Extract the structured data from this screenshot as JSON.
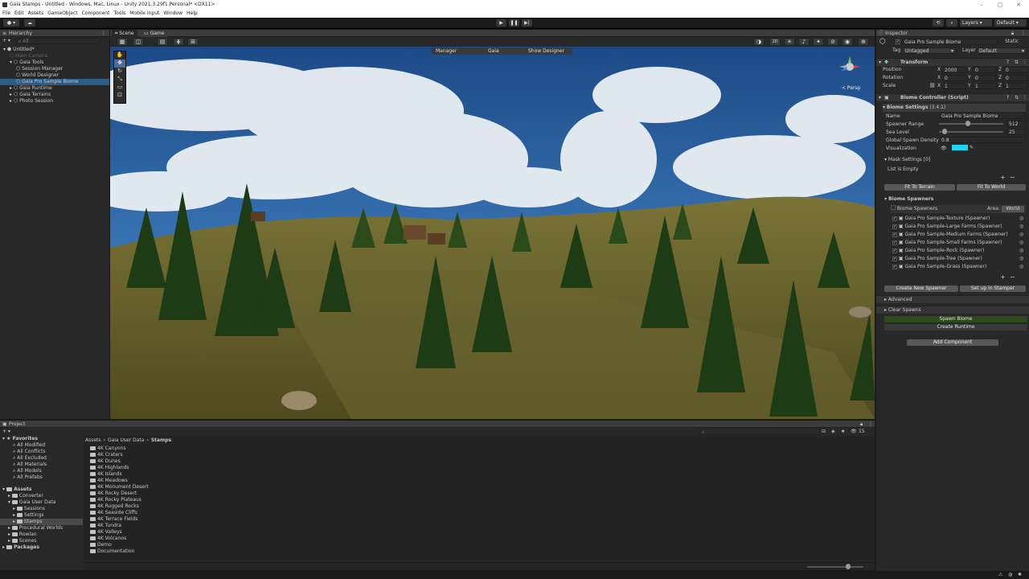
{
  "window": {
    "title": "Gaia Stamps - Untitled - Windows, Mac, Linux - Unity 2021.3.29f1 Personal* <DX11>"
  },
  "menu": [
    "File",
    "Edit",
    "Assets",
    "GameObject",
    "Component",
    "Tools",
    "Mobile Input",
    "Window",
    "Help"
  ],
  "toolbar": {
    "layers": "Layers",
    "layout": "Default"
  },
  "hierarchy": {
    "tab": "Hierarchy",
    "search_placeholder": "All",
    "items": [
      {
        "label": "Untitled*",
        "depth": 0
      },
      {
        "label": "Main Camera",
        "depth": 1
      },
      {
        "label": "Gaia Tools",
        "depth": 1
      },
      {
        "label": "Session Manager",
        "depth": 2
      },
      {
        "label": "World Designer",
        "depth": 2
      },
      {
        "label": "Gaia Pro Sample Biome",
        "depth": 2
      },
      {
        "label": "Gaia Runtime",
        "depth": 1
      },
      {
        "label": "Gaia Terrains",
        "depth": 1
      },
      {
        "label": "Photo Session",
        "depth": 1
      }
    ]
  },
  "scene": {
    "tabs": [
      "Scene",
      "Game"
    ],
    "overlay": {
      "manager": "Manager",
      "gaia": "Gaia",
      "show_designer": "Show Designer"
    },
    "mode_2d": "2D",
    "persp": "< Persp"
  },
  "inspector": {
    "tab": "Inspector",
    "object_name": "Gaia Pro Sample Biome",
    "static": "Static",
    "tag_label": "Tag",
    "tag": "Untagged",
    "layer_label": "Layer",
    "layer": "Default",
    "transform": {
      "title": "Transform",
      "position": {
        "label": "Position",
        "x": "2000",
        "y": "0",
        "z": "0"
      },
      "rotation": {
        "label": "Rotation",
        "x": "0",
        "y": "0",
        "z": "0"
      },
      "scale": {
        "label": "Scale",
        "x": "1",
        "y": "1",
        "z": "1"
      }
    },
    "biome_controller": {
      "title": "Biome Controller (Script)",
      "settings_title": "Biome Settings",
      "version": "(3.4.1)",
      "name_label": "Name",
      "name": "Gaia Pro Sample Biome",
      "spawner_range_label": "Spawner Range",
      "spawner_range": "512",
      "spawner_range_frac": 0.45,
      "sea_level_label": "Sea Level",
      "sea_level": "25",
      "sea_level_frac": 0.05,
      "density_label": "Global Spawn Density",
      "density": "0.8",
      "viz_label": "Visualization",
      "viz_color": "#1fd4f0",
      "mask_settings": "Mask Settings [0]",
      "list_empty": "List is Empty",
      "fit_terrain": "Fit To Terrain",
      "fit_world": "Fit To World",
      "spawners_title": "Biome Spawners",
      "spawners_header": "Biome Spawners",
      "area_label": "Area:",
      "area_value": "World",
      "spawners": [
        "Gaia Pro Sample-Texture (Spawner)",
        "Gaia Pro Sample-Large Farms (Spawner)",
        "Gaia Pro Sample-Medium Farms (Spawner)",
        "Gaia Pro Sample-Small Farms (Spawner)",
        "Gaia Pro Sample-Rock (Spawner)",
        "Gaia Pro Sample-Tree (Spawner)",
        "Gaia Pro Sample-Grass (Spawner)"
      ],
      "create_spawner": "Create New Spawner",
      "setup_stamper": "Set up in Stamper",
      "advanced": "Advanced",
      "clear_spawns": "Clear Spawns",
      "spawn_biome": "Spawn Biome",
      "create_runtime": "Create Runtime"
    },
    "add_component": "Add Component"
  },
  "project": {
    "tab": "Project",
    "favorites_label": "Favorites",
    "favorites": [
      "All Modified",
      "All Conflicts",
      "All Excluded",
      "All Materials",
      "All Models",
      "All Prefabs"
    ],
    "assets_label": "Assets",
    "assets_tree": [
      {
        "label": "Converter",
        "depth": 1
      },
      {
        "label": "Gaia User Data",
        "depth": 1
      },
      {
        "label": "Sessions",
        "depth": 2
      },
      {
        "label": "Settings",
        "depth": 2
      },
      {
        "label": "Stamps",
        "depth": 2
      },
      {
        "label": "Procedural Worlds",
        "depth": 1
      },
      {
        "label": "Rowlan",
        "depth": 1
      },
      {
        "label": "Scenes",
        "depth": 1
      }
    ],
    "packages_label": "Packages",
    "breadcrumb": [
      "Assets",
      "Gaia User Data",
      "Stamps"
    ],
    "hidden_count": "15",
    "folders": [
      "4K Canyons",
      "4K Craters",
      "4K Dunes",
      "4K Highlands",
      "4K Islands",
      "4K Meadows",
      "4K Monument Desert",
      "4K Rocky Desert",
      "4K Rocky Plateaus",
      "4K Rugged Rocks",
      "4K Seaside Cliffs",
      "4K Terrace Fields",
      "4K Tundra",
      "4K Valleys",
      "4K Volcanos",
      "Demo",
      "Documentation"
    ]
  }
}
